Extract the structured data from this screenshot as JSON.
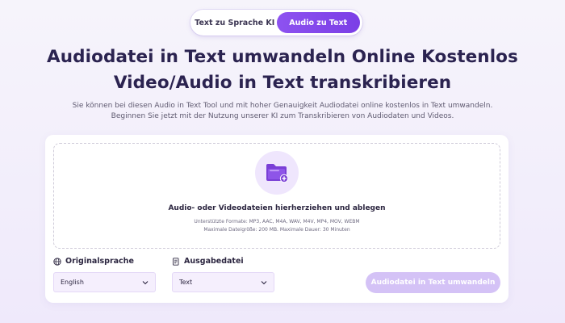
{
  "tabs": [
    {
      "label": "Text zu Sprache KI",
      "active": false
    },
    {
      "label": "Audio zu Text",
      "active": true
    }
  ],
  "heading": {
    "line1": "Audiodatei in Text umwandeln Online Kostenlos",
    "line2": "Video/Audio in Text transkribieren"
  },
  "subtitle": {
    "line1": "Sie können bei diesen Audio in Text Tool und mit hoher Genauigkeit Audiodatei online kostenlos in Text umwandeln.",
    "line2": "Beginnen Sie jetzt mit der Nutzung unserer KI zum Transkribieren von Audiodaten und Videos."
  },
  "upload": {
    "icon": "folder-plus-icon",
    "main_text": "Audio- oder Videodateien hierherziehen und ablegen",
    "formats": "Unterstützte Formate: MP3, AAC, M4A, WAV, M4V, MP4, MOV, WEBM",
    "limits": "Maximale Dateigröße: 200 MB. Maximale Dauer: 30 Minuten"
  },
  "options": {
    "language_label": "Originalsprache",
    "language_value": "English",
    "output_label": "Ausgabedatei",
    "output_value": "Text"
  },
  "convert_button": "Audiodatei in Text umwandeln",
  "colors": {
    "accent": "#7b3ee6",
    "button_disabled": "#d4c2f6",
    "title": "#2b2350"
  }
}
